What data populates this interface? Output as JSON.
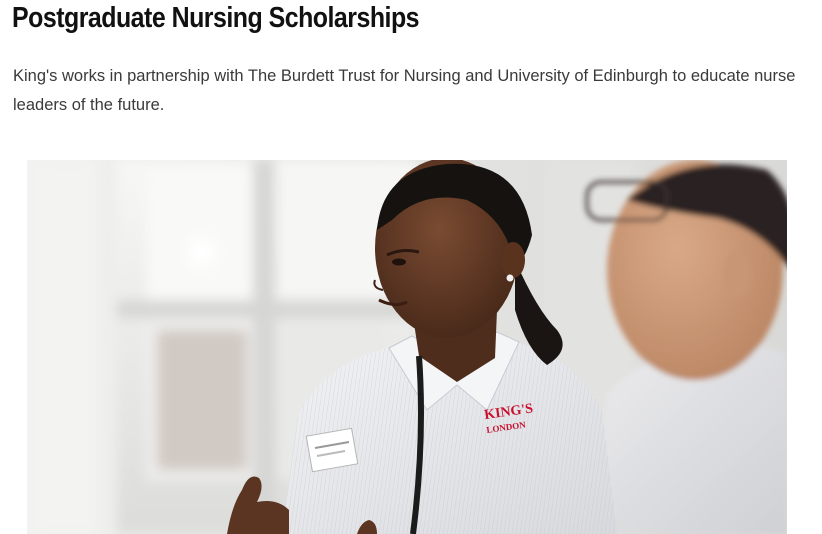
{
  "article": {
    "title": "Postgraduate Nursing Scholarships",
    "intro": "King's works in partnership with The Burdett Trust for Nursing and University of Edinburgh to educate nurse leaders of the future."
  },
  "hero_image": {
    "logo_text": "KING'S LONDON"
  },
  "colors": {
    "title": "#111111",
    "body_text": "#3a3a3a",
    "logo_red": "#c8102e",
    "uniform": "#e6e7ea"
  }
}
